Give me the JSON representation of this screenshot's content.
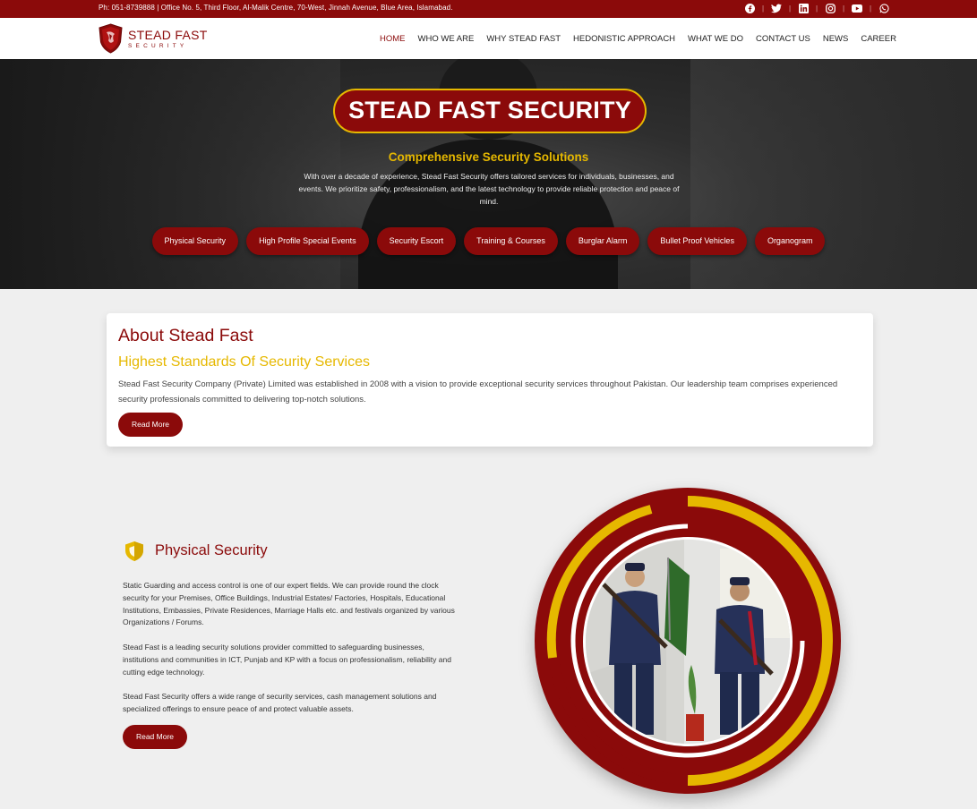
{
  "topbar": {
    "contact": "Ph: 051-8739888 | Office No. 5, Third Floor, Al-Malik Centre, 70-West, Jinnah Avenue, Blue Area, Islamabad.",
    "social_icons": [
      "facebook-icon",
      "twitter-icon",
      "linkedin-icon",
      "instagram-icon",
      "youtube-icon",
      "whatsapp-icon"
    ],
    "separator": "|"
  },
  "brand": {
    "title": "STEAD FAST",
    "subtitle": "SECURITY"
  },
  "nav": {
    "items": [
      "HOME",
      "WHO WE ARE",
      "WHY STEAD FAST",
      "HEDONISTIC APPROACH",
      "WHAT WE DO",
      "CONTACT US",
      "NEWS",
      "CAREER"
    ],
    "active": "HOME"
  },
  "hero": {
    "title": "STEAD FAST SECURITY",
    "subtitle": "Comprehensive Security Solutions",
    "description": "With over a decade of experience, Stead Fast Security offers tailored services for individuals, businesses, and events. We prioritize safety, professionalism, and the latest technology to provide reliable protection and peace of mind.",
    "services": [
      "Physical Security",
      "High Profile Special Events",
      "Security Escort",
      "Training & Courses",
      "Burglar Alarm",
      "Bullet Proof Vehicles",
      "Organogram"
    ]
  },
  "about": {
    "heading": "About Stead Fast",
    "subheading": "Highest Standards Of Security Services",
    "text": "Stead Fast Security Company (Private) Limited was established in 2008 with a vision to provide exceptional security services throughout Pakistan. Our leadership team comprises experienced security professionals committed to delivering top-notch solutions.",
    "button": "Read More"
  },
  "physical_security": {
    "title": "Physical Security",
    "paragraphs": [
      "Static Guarding and access control is one of our expert fields. We can provide round the clock security for your Premises, Office Buildings, Industrial Estates/ Factories, Hospitals, Educational Institutions, Embassies, Private Residences, Marriage Halls etc. and festivals organized by various Organizations / Forums.",
      "Stead Fast is a leading security solutions provider committed to safeguarding businesses, institutions and communities in ICT, Punjab and KP with a focus on professionalism, reliability and cutting edge technology.",
      "Stead Fast Security offers a wide range of security services, cash management solutions and specialized offerings to ensure peace of and protect valuable assets."
    ],
    "button": "Read More"
  },
  "colors": {
    "brand": "#8b0a0a",
    "accent": "#e6b800",
    "background": "#efefef"
  }
}
